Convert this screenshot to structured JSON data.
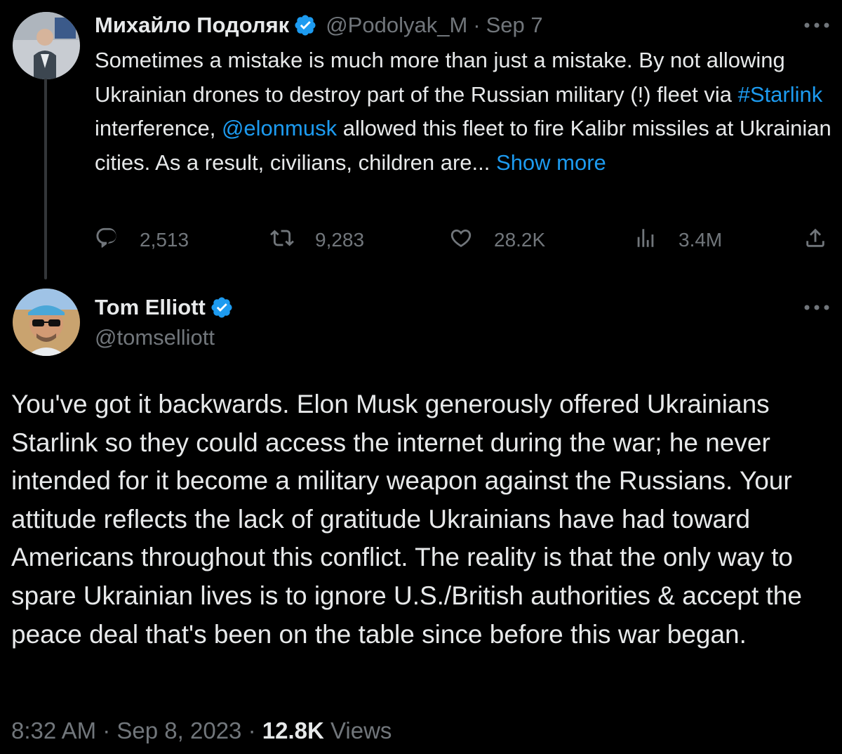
{
  "tweet1": {
    "author_name": "Михайло Подоляк",
    "handle": "@Podolyak_M",
    "separator": "·",
    "date": "Sep 7",
    "text_parts": {
      "p1": "Sometimes a mistake is much more than just a mistake. By not allowing Ukrainian drones to destroy part of the Russian military (!) fleet via ",
      "hashtag": "#Starlink",
      "p2": " interference, ",
      "mention": "@elonmusk",
      "p3": " allowed this fleet to fire Kalibr missiles at Ukrainian cities. As a result, civilians, children are... ",
      "show_more": "Show more"
    },
    "stats": {
      "replies": "2,513",
      "reposts": "9,283",
      "likes": "28.2K",
      "views": "3.4M"
    }
  },
  "tweet2": {
    "author_name": "Tom Elliott",
    "handle": "@tomselliott",
    "text": "You've got it backwards. Elon Musk generously offered Ukrainians Starlink so they could access the internet during the war; he never intended for it become a military weapon against the Russians. Your attitude reflects the lack of gratitude Ukrainians have had toward Americans throughout this conflict. The reality is that the only way to spare Ukrainian lives is to ignore U.S./British authorities & accept the peace deal that's been on the table since before this war began.",
    "time": "8:32 AM",
    "separator": "·",
    "date": "Sep 8, 2023",
    "views_count": "12.8K",
    "views_label": "Views"
  },
  "colors": {
    "background": "#000000",
    "text": "#e7e9ea",
    "muted": "#71767b",
    "link": "#1d9bf0",
    "verified": "#1d9bf0"
  },
  "icons": [
    "verified-badge-icon",
    "more-options-icon",
    "reply-icon",
    "repost-icon",
    "like-icon",
    "views-icon",
    "share-icon"
  ]
}
